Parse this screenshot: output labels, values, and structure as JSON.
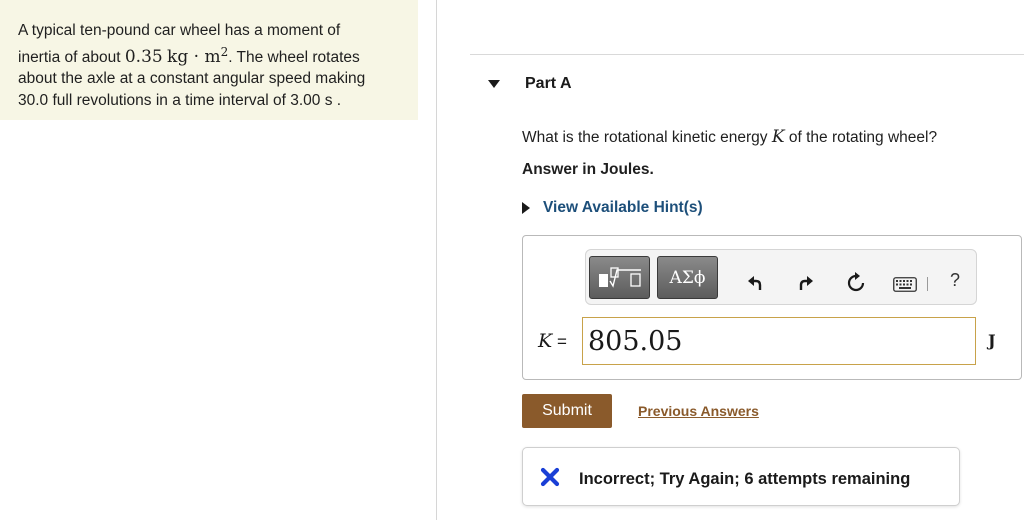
{
  "problem": {
    "text_1": "A typical ten-pound car wheel has a moment of",
    "text_2a": "inertia of about ",
    "math_value": "0.35",
    "math_unit_kg": "kg",
    "math_dot": "·",
    "math_unit_m": "m",
    "math_exponent": "2",
    "text_2b": ". The wheel rotates",
    "text_3": "about the axle at a constant angular speed making",
    "text_4": "30.0 full revolutions in a time interval of 3.00 s ."
  },
  "part": {
    "title": "Part A",
    "expanded": true
  },
  "question": {
    "text_before": "What is the rotational kinetic energy ",
    "symbol": "K",
    "text_after": " of the rotating wheel?",
    "answer_note": "Answer in Joules."
  },
  "hints": {
    "label": "View Available Hint(s)"
  },
  "toolbar": {
    "template_label": "√□",
    "greek_label": "ΑΣϕ",
    "undo_icon": "undo-icon",
    "redo_icon": "redo-icon",
    "reset_icon": "reset-icon",
    "keyboard_icon": "keyboard-icon",
    "help_label": "?"
  },
  "answer": {
    "variable": "K",
    "equals": "=",
    "value": "805.05",
    "unit": "J"
  },
  "actions": {
    "submit_label": "Submit",
    "previous_answers_label": "Previous Answers"
  },
  "feedback": {
    "icon": "x-icon",
    "message": "Incorrect; Try Again; 6 attempts remaining",
    "status_color": "#1a3fd6"
  },
  "colors": {
    "problem_bg": "#f7f6e5",
    "link_blue": "#1d4f7a",
    "submit_brown": "#8a5a2b",
    "input_border": "#c8a24a"
  }
}
